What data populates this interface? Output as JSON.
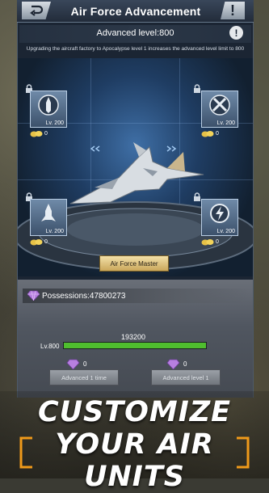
{
  "header": {
    "title": "Air Force Advancement",
    "help_label": "!"
  },
  "level": {
    "text": "Advanced level:800",
    "info_label": "!"
  },
  "description": "Upgrading the aircraft factory to Apocalypse level 1 increases the advanced level limit to 800",
  "slots": [
    {
      "level": "Lv. 200",
      "cost": "0",
      "icon": "missile-emblem-icon"
    },
    {
      "level": "Lv. 200",
      "cost": "0",
      "icon": "crossed-missiles-emblem-icon"
    },
    {
      "level": "Lv. 200",
      "cost": "0",
      "icon": "rocket-emblem-icon"
    },
    {
      "level": "Lv. 200",
      "cost": "0",
      "icon": "lightning-emblem-icon"
    }
  ],
  "master_button": "Air Force Master",
  "possessions": "Possessions:47800273",
  "progress": {
    "value_text": "193200",
    "level_text": "Lv.800",
    "fill_fraction": 1.0
  },
  "advance": {
    "once_cost": "0",
    "once_label": "Advanced 1 time",
    "level_cost": "0",
    "level_label": "Advanced level 1"
  },
  "banner": {
    "line1": "CUSTOMIZE",
    "line2": "YOUR AIR UNITS"
  },
  "colors": {
    "accent_gold": "#caa75b",
    "progress_green": "#4fbe2e",
    "bracket_orange": "#f09a1a"
  }
}
